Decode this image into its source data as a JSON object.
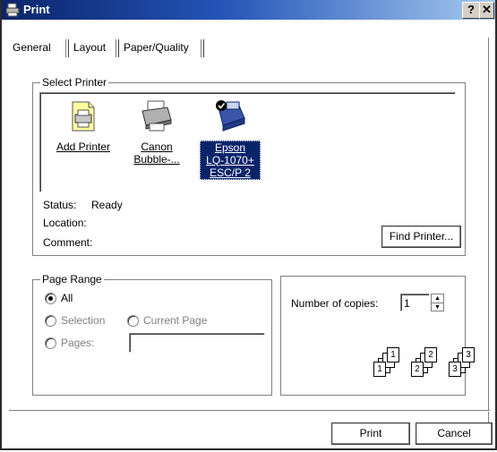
{
  "window": {
    "title": "Print",
    "help_button": "?",
    "close_button": "✕"
  },
  "tabs": [
    {
      "label": "General",
      "active": true
    },
    {
      "label": "Layout",
      "active": false
    },
    {
      "label": "Paper/Quality",
      "active": false
    }
  ],
  "select_printer": {
    "legend": "Select Printer",
    "printers": [
      {
        "label_lines": [
          "Add Printer"
        ],
        "icon": "add-printer-icon",
        "selected": false
      },
      {
        "label_lines": [
          "Canon",
          "Bubble-..."
        ],
        "icon": "printer-icon",
        "selected": false
      },
      {
        "label_lines": [
          "Epson",
          "LQ-1070+",
          "ESC/P 2"
        ],
        "icon": "default-printer-icon",
        "selected": true
      }
    ],
    "status_label": "Status:",
    "status_value": "Ready",
    "location_label": "Location:",
    "location_value": "",
    "comment_label": "Comment:",
    "comment_value": "",
    "find_printer_button": "Find Printer..."
  },
  "page_range": {
    "legend": "Page Range",
    "all_label": "All",
    "selection_label": "Selection",
    "current_page_label": "Current Page",
    "pages_label": "Pages:",
    "pages_value": "",
    "selected_option": "all"
  },
  "copies": {
    "label": "Number of copies:",
    "value": "1",
    "collate_pages": [
      "1",
      "2",
      "3"
    ]
  },
  "footer": {
    "print_button": "Print",
    "cancel_button": "Cancel"
  },
  "colors": {
    "title_start": "#0a246a",
    "title_end": "#a6caf0",
    "selection": "#0a246a"
  }
}
